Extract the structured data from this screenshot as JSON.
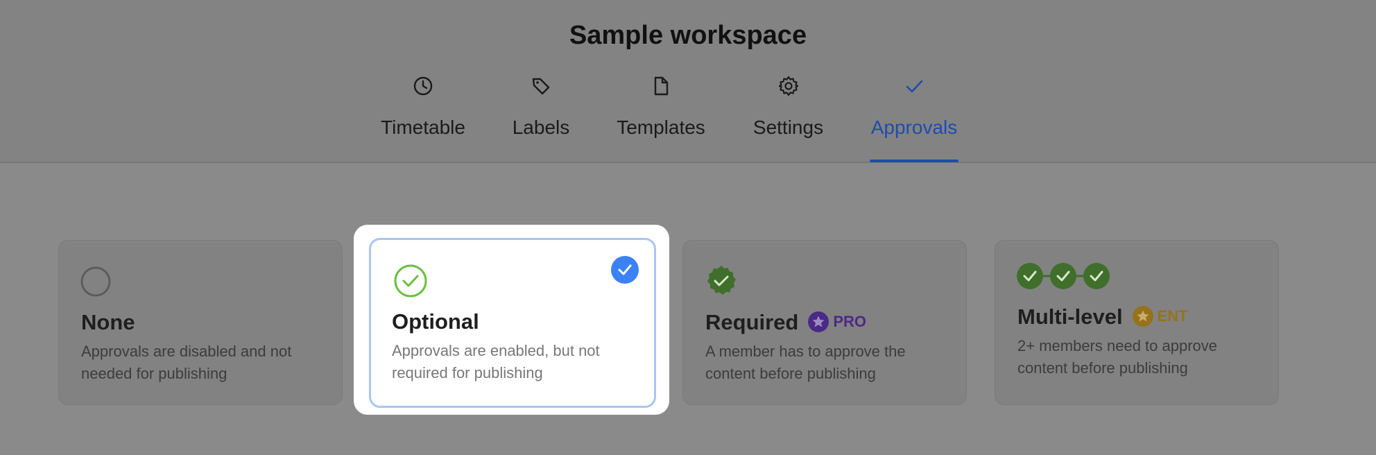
{
  "header": {
    "title": "Sample workspace"
  },
  "tabs": [
    {
      "label": "Timetable",
      "icon": "clock-icon"
    },
    {
      "label": "Labels",
      "icon": "tag-icon"
    },
    {
      "label": "Templates",
      "icon": "file-icon"
    },
    {
      "label": "Settings",
      "icon": "gear-icon"
    },
    {
      "label": "Approvals",
      "icon": "check-icon",
      "active": true
    }
  ],
  "options": [
    {
      "title": "None",
      "description": "Approvals are disabled and not needed for publishing",
      "icon": "empty-circle-icon"
    },
    {
      "title": "Optional",
      "description": "Approvals are enabled, but not required for publishing",
      "icon": "check-circle-outline-icon",
      "selected": true
    },
    {
      "title": "Required",
      "description": "A member has to approve the content before publishing",
      "icon": "check-badge-icon",
      "badge": "PRO"
    },
    {
      "title": "Multi-level",
      "description": "2+ members need to approve content before publishing",
      "icon": "multi-check-icon",
      "badge": "ENT"
    }
  ],
  "colors": {
    "accent": "#1f4bb0",
    "selected_check": "#3b82f6",
    "optional_green": "#6abf3f",
    "required_green": "#3f6f2a",
    "pro": "#4a2a86",
    "ent": "#96721c"
  }
}
